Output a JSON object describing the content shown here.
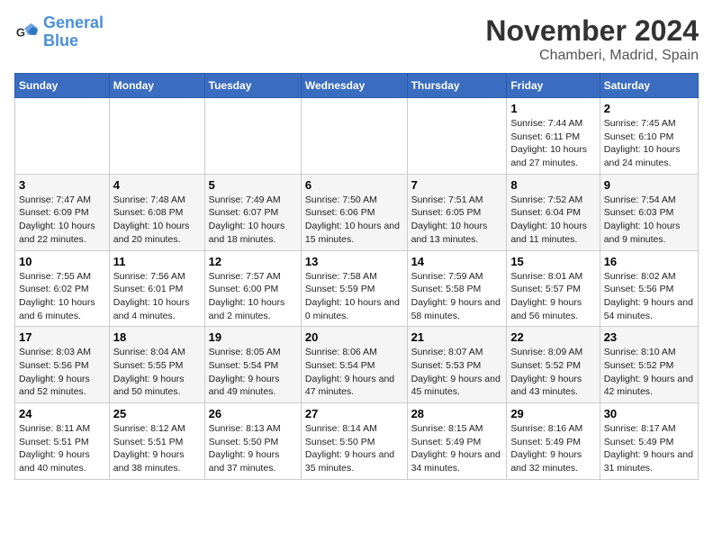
{
  "logo": {
    "line1": "General",
    "line2": "Blue"
  },
  "title": "November 2024",
  "location": "Chamberi, Madrid, Spain",
  "days_of_week": [
    "Sunday",
    "Monday",
    "Tuesday",
    "Wednesday",
    "Thursday",
    "Friday",
    "Saturday"
  ],
  "weeks": [
    [
      {
        "day": "",
        "info": ""
      },
      {
        "day": "",
        "info": ""
      },
      {
        "day": "",
        "info": ""
      },
      {
        "day": "",
        "info": ""
      },
      {
        "day": "",
        "info": ""
      },
      {
        "day": "1",
        "info": "Sunrise: 7:44 AM\nSunset: 6:11 PM\nDaylight: 10 hours and 27 minutes."
      },
      {
        "day": "2",
        "info": "Sunrise: 7:45 AM\nSunset: 6:10 PM\nDaylight: 10 hours and 24 minutes."
      }
    ],
    [
      {
        "day": "3",
        "info": "Sunrise: 7:47 AM\nSunset: 6:09 PM\nDaylight: 10 hours and 22 minutes."
      },
      {
        "day": "4",
        "info": "Sunrise: 7:48 AM\nSunset: 6:08 PM\nDaylight: 10 hours and 20 minutes."
      },
      {
        "day": "5",
        "info": "Sunrise: 7:49 AM\nSunset: 6:07 PM\nDaylight: 10 hours and 18 minutes."
      },
      {
        "day": "6",
        "info": "Sunrise: 7:50 AM\nSunset: 6:06 PM\nDaylight: 10 hours and 15 minutes."
      },
      {
        "day": "7",
        "info": "Sunrise: 7:51 AM\nSunset: 6:05 PM\nDaylight: 10 hours and 13 minutes."
      },
      {
        "day": "8",
        "info": "Sunrise: 7:52 AM\nSunset: 6:04 PM\nDaylight: 10 hours and 11 minutes."
      },
      {
        "day": "9",
        "info": "Sunrise: 7:54 AM\nSunset: 6:03 PM\nDaylight: 10 hours and 9 minutes."
      }
    ],
    [
      {
        "day": "10",
        "info": "Sunrise: 7:55 AM\nSunset: 6:02 PM\nDaylight: 10 hours and 6 minutes."
      },
      {
        "day": "11",
        "info": "Sunrise: 7:56 AM\nSunset: 6:01 PM\nDaylight: 10 hours and 4 minutes."
      },
      {
        "day": "12",
        "info": "Sunrise: 7:57 AM\nSunset: 6:00 PM\nDaylight: 10 hours and 2 minutes."
      },
      {
        "day": "13",
        "info": "Sunrise: 7:58 AM\nSunset: 5:59 PM\nDaylight: 10 hours and 0 minutes."
      },
      {
        "day": "14",
        "info": "Sunrise: 7:59 AM\nSunset: 5:58 PM\nDaylight: 9 hours and 58 minutes."
      },
      {
        "day": "15",
        "info": "Sunrise: 8:01 AM\nSunset: 5:57 PM\nDaylight: 9 hours and 56 minutes."
      },
      {
        "day": "16",
        "info": "Sunrise: 8:02 AM\nSunset: 5:56 PM\nDaylight: 9 hours and 54 minutes."
      }
    ],
    [
      {
        "day": "17",
        "info": "Sunrise: 8:03 AM\nSunset: 5:56 PM\nDaylight: 9 hours and 52 minutes."
      },
      {
        "day": "18",
        "info": "Sunrise: 8:04 AM\nSunset: 5:55 PM\nDaylight: 9 hours and 50 minutes."
      },
      {
        "day": "19",
        "info": "Sunrise: 8:05 AM\nSunset: 5:54 PM\nDaylight: 9 hours and 49 minutes."
      },
      {
        "day": "20",
        "info": "Sunrise: 8:06 AM\nSunset: 5:54 PM\nDaylight: 9 hours and 47 minutes."
      },
      {
        "day": "21",
        "info": "Sunrise: 8:07 AM\nSunset: 5:53 PM\nDaylight: 9 hours and 45 minutes."
      },
      {
        "day": "22",
        "info": "Sunrise: 8:09 AM\nSunset: 5:52 PM\nDaylight: 9 hours and 43 minutes."
      },
      {
        "day": "23",
        "info": "Sunrise: 8:10 AM\nSunset: 5:52 PM\nDaylight: 9 hours and 42 minutes."
      }
    ],
    [
      {
        "day": "24",
        "info": "Sunrise: 8:11 AM\nSunset: 5:51 PM\nDaylight: 9 hours and 40 minutes."
      },
      {
        "day": "25",
        "info": "Sunrise: 8:12 AM\nSunset: 5:51 PM\nDaylight: 9 hours and 38 minutes."
      },
      {
        "day": "26",
        "info": "Sunrise: 8:13 AM\nSunset: 5:50 PM\nDaylight: 9 hours and 37 minutes."
      },
      {
        "day": "27",
        "info": "Sunrise: 8:14 AM\nSunset: 5:50 PM\nDaylight: 9 hours and 35 minutes."
      },
      {
        "day": "28",
        "info": "Sunrise: 8:15 AM\nSunset: 5:49 PM\nDaylight: 9 hours and 34 minutes."
      },
      {
        "day": "29",
        "info": "Sunrise: 8:16 AM\nSunset: 5:49 PM\nDaylight: 9 hours and 32 minutes."
      },
      {
        "day": "30",
        "info": "Sunrise: 8:17 AM\nSunset: 5:49 PM\nDaylight: 9 hours and 31 minutes."
      }
    ]
  ]
}
